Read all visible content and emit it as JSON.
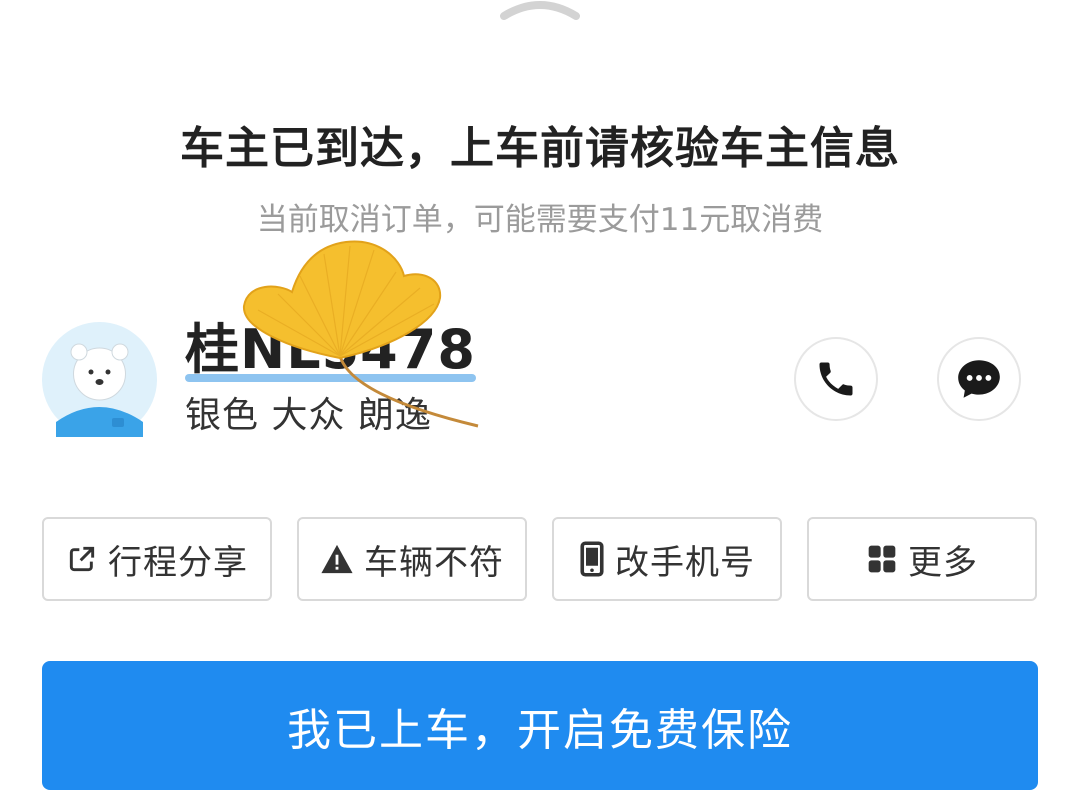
{
  "header": {
    "title": "车主已到达，上车前请核验车主信息",
    "subtitle": "当前取消订单，可能需要支付11元取消费"
  },
  "driver": {
    "plate": "桂NL5478",
    "car_description": "银色 大众 朗逸"
  },
  "contact": {
    "phone_icon": "phone-icon",
    "message_icon": "message-icon"
  },
  "actions": [
    {
      "label": "行程分享",
      "icon": "share-icon"
    },
    {
      "label": "车辆不符",
      "icon": "warning-icon"
    },
    {
      "label": "改手机号",
      "icon": "mobile-phone-icon"
    },
    {
      "label": "更多",
      "icon": "grid-icon"
    }
  ],
  "primary_button": {
    "label": "我已上车，开启免费保险"
  },
  "colors": {
    "accent": "#1f8bf0",
    "title_text": "#222222",
    "subtitle_text": "#9b9b9b",
    "border": "#d9d9d9"
  }
}
